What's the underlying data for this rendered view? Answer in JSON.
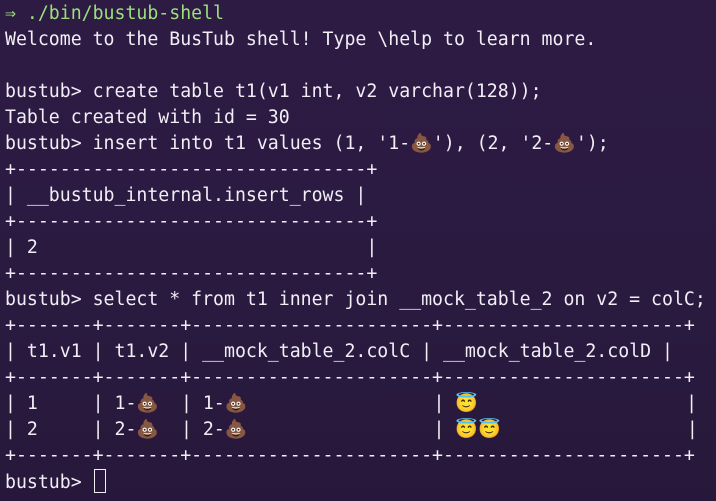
{
  "shell": {
    "prompt_symbol": "⇒",
    "command": "./bin/bustub-shell",
    "welcome": "Welcome to the BusTub shell! Type \\help to learn more.",
    "prompt": "bustub> "
  },
  "history": {
    "cmd_create": "create table t1(v1 int, v2 varchar(128));",
    "resp_create": "Table created with id = 30",
    "cmd_insert": "insert into t1 values (1, '1-💩'), (2, '2-💩');",
    "cmd_select": "select * from t1 inner join __mock_table_2 on v2 = colC;"
  },
  "insert_result": {
    "border": "+--------------------------------+",
    "header": "| __bustub_internal.insert_rows |",
    "row": "| 2                              |"
  },
  "select_result": {
    "border": "+-------+-------+----------------------+----------------------+",
    "header": "| t1.v1 | t1.v2 | __mock_table_2.colC | __mock_table_2.colD |",
    "rows": [
      "| 1     | 1-💩  | 1-💩                 | 😇                   |",
      "| 2     | 2-💩  | 2-💩                 | 😇😇                 |"
    ]
  },
  "final_prompt": "bustub> ",
  "colors": {
    "background": "#2b1a3f",
    "text": "#f1eef6",
    "accent_green": "#9be07a"
  }
}
